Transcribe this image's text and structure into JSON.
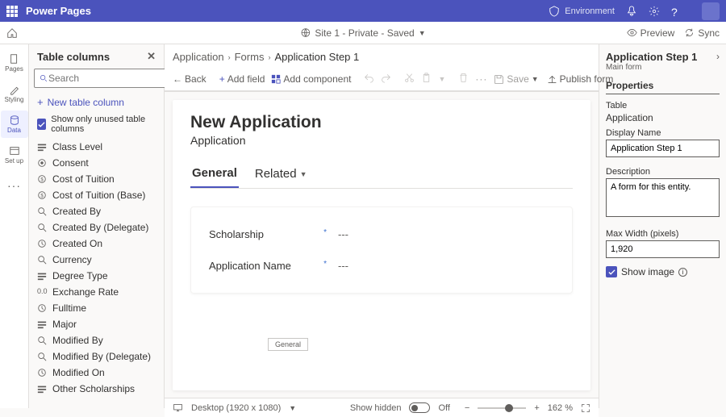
{
  "topbar": {
    "title": "Power Pages",
    "env_label": "Environment"
  },
  "subbar": {
    "site": "Site 1 - Private - Saved",
    "preview": "Preview",
    "sync": "Sync"
  },
  "rail": {
    "pages": "Pages",
    "styling": "Styling",
    "data": "Data",
    "setup": "Set up"
  },
  "crumbs": {
    "c1": "Application",
    "c2": "Forms",
    "c3": "Application Step 1"
  },
  "cmd": {
    "back": "Back",
    "addfield": "Add field",
    "addcomp": "Add component",
    "save": "Save",
    "publish": "Publish form"
  },
  "leftpanel": {
    "title": "Table columns",
    "searchPlaceholder": "Search",
    "newcol": "New table column",
    "showonly": "Show only unused table columns",
    "cols": [
      "Class Level",
      "Consent",
      "Cost of Tuition",
      "Cost of Tuition (Base)",
      "Created By",
      "Created By (Delegate)",
      "Created On",
      "Currency",
      "Degree Type",
      "Exchange Rate",
      "Fulltime",
      "Major",
      "Modified By",
      "Modified By (Delegate)",
      "Modified On",
      "Other Scholarships"
    ],
    "coltypes": [
      "opt",
      "yn",
      "cur",
      "cur",
      "lk",
      "lk",
      "dt",
      "lk",
      "opt",
      "num",
      "dt",
      "opt",
      "lk",
      "lk",
      "dt",
      "opt"
    ]
  },
  "form": {
    "title": "New Application",
    "entity": "Application",
    "tabs": {
      "general": "General",
      "related": "Related"
    },
    "fields": [
      {
        "label": "Scholarship",
        "value": "---"
      },
      {
        "label": "Application Name",
        "value": "---"
      }
    ],
    "miniTab": "General"
  },
  "footer": {
    "viewport": "Desktop (1920 x 1080)",
    "showhidden": "Show hidden",
    "toggle": "Off",
    "zoom": "162 %"
  },
  "right": {
    "title": "Application Step 1",
    "sub": "Main form",
    "section": "Properties",
    "tablelbl": "Table",
    "tableval": "Application",
    "dnlbl": "Display Name",
    "dnval": "Application Step 1",
    "desclbl": "Description",
    "descval": "A form for this entity.",
    "maxwlbl": "Max Width (pixels)",
    "maxwval": "1,920",
    "showimg": "Show image"
  }
}
